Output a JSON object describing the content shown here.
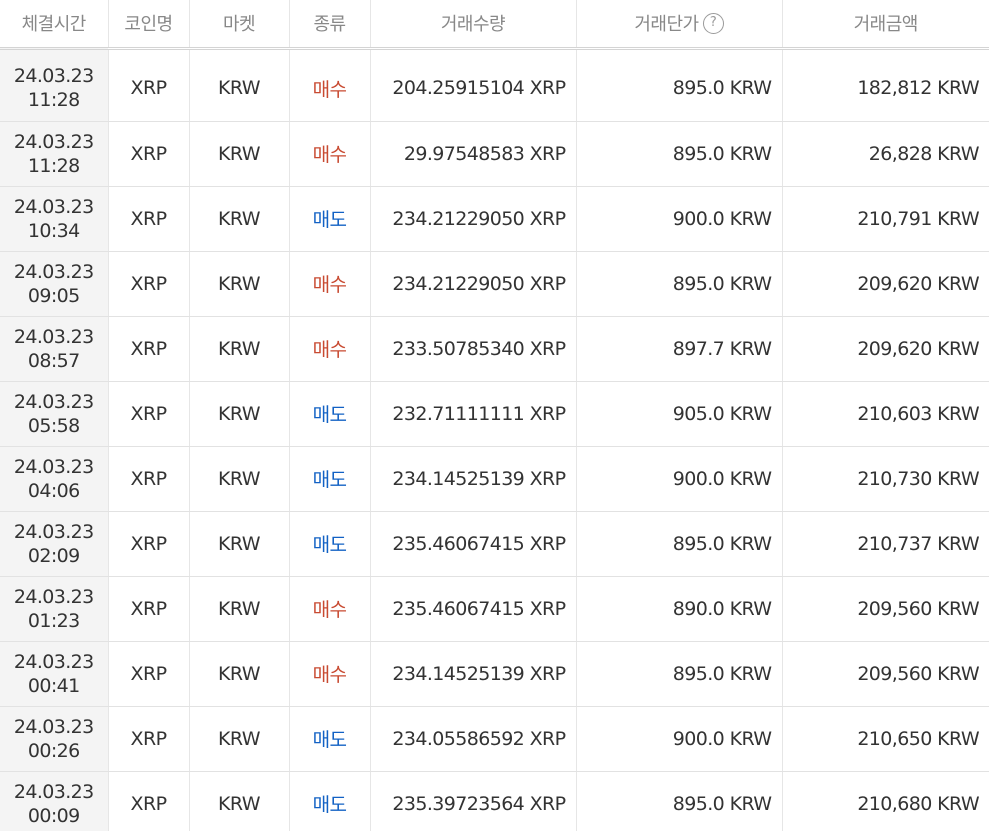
{
  "colors": {
    "buy": "#c84a31",
    "sell": "#1261c4",
    "header_text": "#888888"
  },
  "headers": [
    "체결시간",
    "코인명",
    "마켓",
    "종류",
    "거래수량",
    "거래단가",
    "거래금액"
  ],
  "help_icon": {
    "name": "help-circle-icon",
    "glyph": "?"
  },
  "rows": [
    {
      "date": "24.03.23",
      "time": "11:28",
      "coin": "XRP",
      "market": "KRW",
      "side": "매수",
      "type": "buy",
      "quantity": "204.25915104 XRP",
      "price": "895.0 KRW",
      "amount": "182,812 KRW"
    },
    {
      "date": "24.03.23",
      "time": "11:28",
      "coin": "XRP",
      "market": "KRW",
      "side": "매수",
      "type": "buy",
      "quantity": "29.97548583 XRP",
      "price": "895.0 KRW",
      "amount": "26,828 KRW"
    },
    {
      "date": "24.03.23",
      "time": "10:34",
      "coin": "XRP",
      "market": "KRW",
      "side": "매도",
      "type": "sell",
      "quantity": "234.21229050 XRP",
      "price": "900.0 KRW",
      "amount": "210,791 KRW"
    },
    {
      "date": "24.03.23",
      "time": "09:05",
      "coin": "XRP",
      "market": "KRW",
      "side": "매수",
      "type": "buy",
      "quantity": "234.21229050 XRP",
      "price": "895.0 KRW",
      "amount": "209,620 KRW"
    },
    {
      "date": "24.03.23",
      "time": "08:57",
      "coin": "XRP",
      "market": "KRW",
      "side": "매수",
      "type": "buy",
      "quantity": "233.50785340 XRP",
      "price": "897.7 KRW",
      "amount": "209,620 KRW"
    },
    {
      "date": "24.03.23",
      "time": "05:58",
      "coin": "XRP",
      "market": "KRW",
      "side": "매도",
      "type": "sell",
      "quantity": "232.71111111 XRP",
      "price": "905.0 KRW",
      "amount": "210,603 KRW"
    },
    {
      "date": "24.03.23",
      "time": "04:06",
      "coin": "XRP",
      "market": "KRW",
      "side": "매도",
      "type": "sell",
      "quantity": "234.14525139 XRP",
      "price": "900.0 KRW",
      "amount": "210,730 KRW"
    },
    {
      "date": "24.03.23",
      "time": "02:09",
      "coin": "XRP",
      "market": "KRW",
      "side": "매도",
      "type": "sell",
      "quantity": "235.46067415 XRP",
      "price": "895.0 KRW",
      "amount": "210,737 KRW"
    },
    {
      "date": "24.03.23",
      "time": "01:23",
      "coin": "XRP",
      "market": "KRW",
      "side": "매수",
      "type": "buy",
      "quantity": "235.46067415 XRP",
      "price": "890.0 KRW",
      "amount": "209,560 KRW"
    },
    {
      "date": "24.03.23",
      "time": "00:41",
      "coin": "XRP",
      "market": "KRW",
      "side": "매수",
      "type": "buy",
      "quantity": "234.14525139 XRP",
      "price": "895.0 KRW",
      "amount": "209,560 KRW"
    },
    {
      "date": "24.03.23",
      "time": "00:26",
      "coin": "XRP",
      "market": "KRW",
      "side": "매도",
      "type": "sell",
      "quantity": "234.05586592 XRP",
      "price": "900.0 KRW",
      "amount": "210,650 KRW"
    },
    {
      "date": "24.03.23",
      "time": "00:09",
      "coin": "XRP",
      "market": "KRW",
      "side": "매도",
      "type": "sell",
      "quantity": "235.39723564 XRP",
      "price": "895.0 KRW",
      "amount": "210,680 KRW"
    }
  ]
}
